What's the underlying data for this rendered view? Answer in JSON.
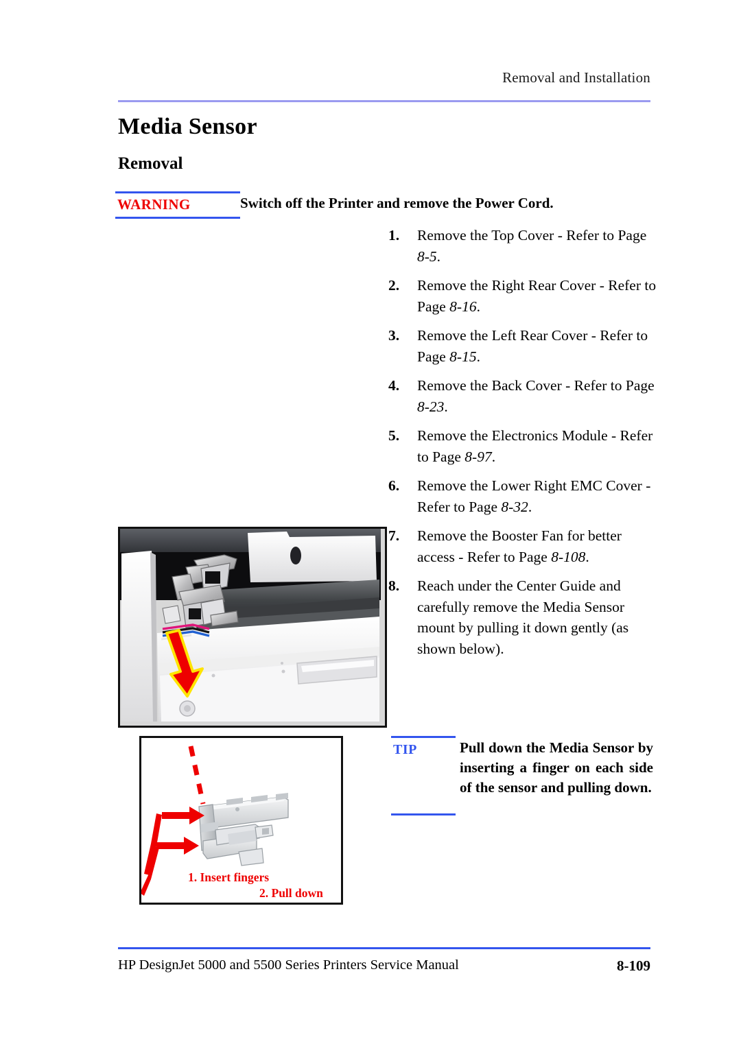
{
  "header": {
    "running_head": "Removal and Installation"
  },
  "titles": {
    "page_title": "Media Sensor",
    "section_title": "Removal"
  },
  "warning": {
    "label": "WARNING",
    "text": "Switch off the Printer and remove the Power Cord.",
    "label_color": "#ee0000",
    "rule_color": "#3355ee"
  },
  "steps": [
    {
      "num": "1.",
      "text_before": "Remove the Top Cover - Refer to Page ",
      "page_ref": "8-5",
      "text_after": "."
    },
    {
      "num": "2.",
      "text_before": "Remove the Right Rear Cover - Refer to Page ",
      "page_ref": "8-16",
      "text_after": "."
    },
    {
      "num": "3.",
      "text_before": "Remove the Left Rear Cover - Refer to Page ",
      "page_ref": "8-15",
      "text_after": "."
    },
    {
      "num": "4.",
      "text_before": "Remove the Back Cover - Refer to Page ",
      "page_ref": "8-23",
      "text_after": "."
    },
    {
      "num": "5.",
      "text_before": "Remove the Electronics Module - Refer to Page ",
      "page_ref": "8-97",
      "text_after": "."
    },
    {
      "num": "6.",
      "text_before": "Remove the Lower Right EMC Cover - Refer to Page ",
      "page_ref": "8-32",
      "text_after": "."
    },
    {
      "num": "7.",
      "text_before": "Remove the Booster Fan for better access - Refer to Page ",
      "page_ref": "8-108",
      "text_after": "."
    },
    {
      "num": "8.",
      "text_before": "Reach under the Center Guide and carefully remove the Media Sensor mount by pulling it down gently (as shown below).",
      "page_ref": "",
      "text_after": ""
    }
  ],
  "figures": {
    "photo": {
      "name": "media-sensor-photo",
      "caption": "",
      "arrow_color": "#ee0000",
      "arrow_outline_color": "#ffe400"
    },
    "drawing": {
      "name": "media-sensor-drawing",
      "label_1": "1. Insert fingers",
      "label_2": "2. Pull down",
      "label_color": "#ee0000",
      "dashed_line_color": "#ee0000"
    }
  },
  "tip": {
    "label": "TIP",
    "text": "Pull down the Media Sensor by inserting a finger on each side of the sensor and pulling down.",
    "label_color": "#3355ee",
    "rule_color": "#3355ee"
  },
  "footer": {
    "manual_title": "HP DesignJet 5000 and 5500 Series Printers Service Manual",
    "page_number": "8-109",
    "rule_color": "#3355ee"
  }
}
